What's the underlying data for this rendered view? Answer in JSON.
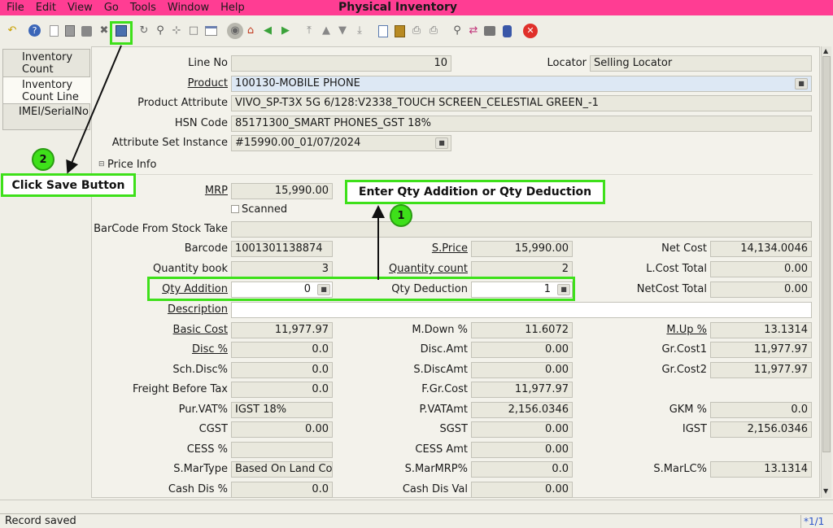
{
  "window_title": "Physical Inventory",
  "menu": [
    "File",
    "Edit",
    "View",
    "Go",
    "Tools",
    "Window",
    "Help"
  ],
  "side_tabs": [
    "Inventory Count",
    "Inventory Count Line",
    "IMEI/SerialNo"
  ],
  "section_price_info": "Price Info",
  "form": {
    "line_no_label": "Line No",
    "line_no": "10",
    "locator_label": "Locator",
    "locator": "Selling Locator",
    "product_label": "Product",
    "product": "100130-MOBILE PHONE",
    "product_attribute_label": "Product Attribute",
    "product_attribute": "VIVO_SP-T3X 5G 6/128:V2338_TOUCH SCREEN_CELESTIAL GREEN_-1",
    "hsn_label": "HSN Code",
    "hsn": "85171300_SMART PHONES_GST 18%",
    "attr_set_label": "Attribute Set Instance",
    "attr_set": "#15990.00_01/07/2024",
    "mrp_label": "MRP",
    "mrp": "15,990.00",
    "scanned_label": "Scanned",
    "barcode_stock_label": "BarCode From Stock Take",
    "barcode_label": "Barcode",
    "barcode": "1001301138874",
    "sprice_label": "S.Price",
    "sprice": "15,990.00",
    "net_cost_label": "Net Cost",
    "net_cost": "14,134.0046",
    "qty_book_label": "Quantity book",
    "qty_book": "3",
    "qty_count_label": "Quantity count",
    "qty_count": "2",
    "lcost_total_label": "L.Cost Total",
    "lcost_total": "0.00",
    "qty_add_label": "Qty Addition",
    "qty_add": "0",
    "qty_ded_label": "Qty Deduction",
    "qty_ded": "1",
    "netcost_total_label": "NetCost Total",
    "netcost_total": "0.00",
    "description_label": "Description",
    "basic_cost_label": "Basic Cost",
    "basic_cost": "11,977.97",
    "mdown_label": "M.Down %",
    "mdown": "11.6072",
    "mup_label": "M.Up %",
    "mup": "13.1314",
    "disc_label": "Disc %",
    "disc": "0.0",
    "disc_amt_label": "Disc.Amt",
    "disc_amt": "0.00",
    "grcost1_label": "Gr.Cost1",
    "grcost1": "11,977.97",
    "sch_disc_label": "Sch.Disc%",
    "sch_disc": "0.0",
    "s_disc_amt_label": "S.DiscAmt",
    "s_disc_amt": "0.00",
    "grcost2_label": "Gr.Cost2",
    "grcost2": "11,977.97",
    "freight_label": "Freight Before Tax",
    "freight": "0.0",
    "fgrcost_label": "F.Gr.Cost",
    "fgrcost": "11,977.97",
    "pur_vat_label": "Pur.VAT%",
    "pur_vat": "IGST 18%",
    "pvat_amt_label": "P.VATAmt",
    "pvat_amt": "2,156.0346",
    "gkm_label": "GKM %",
    "gkm": "0.0",
    "cgst_label": "CGST",
    "cgst": "0.00",
    "sgst_label": "SGST",
    "sgst": "0.00",
    "igst_label": "IGST",
    "igst": "2,156.0346",
    "cess_label": "CESS %",
    "cess_amt_label": "CESS Amt",
    "cess_amt": "0.00",
    "smartype_label": "S.MarType",
    "smartype": "Based On Land Cost",
    "smarmrp_label": "S.MarMRP%",
    "smarmrp": "0.0",
    "smarlc_label": "S.MarLC%",
    "smarlc": "13.1314",
    "cash_dis_label": "Cash Dis %",
    "cash_dis": "0.0",
    "cash_dis_val_label": "Cash Dis Val",
    "cash_dis_val": "0.00"
  },
  "annotations": {
    "step1_number": "1",
    "step1_text": "Enter Qty Addition or Qty Deduction",
    "step2_number": "2",
    "step2_text": "Click Save Button"
  },
  "status": {
    "message": "Record saved",
    "record": "*1/1"
  },
  "colors": {
    "menubar": "#ff3d93",
    "highlight": "#3ee01a"
  }
}
